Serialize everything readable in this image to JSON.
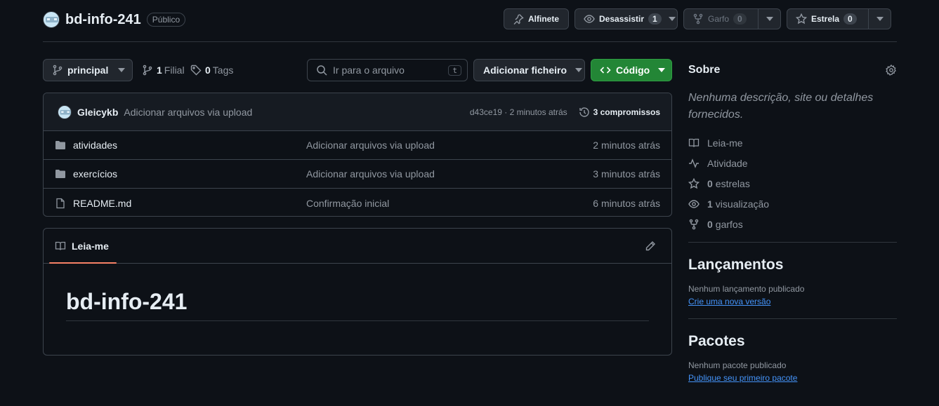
{
  "repo": {
    "name": "bd-info-241",
    "visibility": "Público"
  },
  "actions": {
    "pin_label": "Alfinete",
    "watch_label": "Desassistir",
    "watch_count": "1",
    "fork_label": "Garfo",
    "fork_count": "0",
    "star_label": "Estrela",
    "star_count": "0"
  },
  "toolbar": {
    "branch": "principal",
    "branches_count": "1",
    "branches_label": "Filial",
    "tags_count": "0",
    "tags_label": "Tags",
    "search_placeholder": "Ir para o arquivo",
    "search_shortcut": "t",
    "add_file_label": "Adicionar ficheiro",
    "code_label": "Código"
  },
  "latest_commit": {
    "author": "Gleicykb",
    "message": "Adicionar arquivos via upload",
    "meta": "d43ce19 · 2 minutos atrás",
    "commits_label": "3 compromissos"
  },
  "files": [
    {
      "type": "folder",
      "name": "atividades",
      "message": "Adicionar arquivos via upload",
      "date": "2 minutos atrás"
    },
    {
      "type": "folder",
      "name": "exercícios",
      "message": "Adicionar arquivos via upload",
      "date": "3 minutos atrás"
    },
    {
      "type": "file",
      "name": "README.md",
      "message": "Confirmação inicial",
      "date": "6 minutos atrás"
    }
  ],
  "readme": {
    "tab_label": "Leia-me",
    "heading": "bd-info-241"
  },
  "sidebar": {
    "about_title": "Sobre",
    "about_desc": "Nenhuma descrição, site ou detalhes fornecidos.",
    "items": [
      {
        "icon": "book-icon",
        "count": "",
        "label": "Leia-me"
      },
      {
        "icon": "pulse-icon",
        "count": "",
        "label": "Atividade"
      },
      {
        "icon": "star-icon",
        "count": "0",
        "label": "estrelas"
      },
      {
        "icon": "eye-icon",
        "count": "1",
        "label": "visualização"
      },
      {
        "icon": "fork-icon",
        "count": "0",
        "label": "garfos"
      }
    ],
    "releases_title": "Lançamentos",
    "releases_text": "Nenhum lançamento publicado",
    "releases_link": "Crie uma nova versão",
    "packages_title": "Pacotes",
    "packages_text": "Nenhum pacote publicado",
    "packages_link": "Publique seu primeiro pacote"
  },
  "colors": {
    "accent_green": "#238636",
    "link_blue": "#4493f8",
    "tab_underline": "#f78166"
  }
}
